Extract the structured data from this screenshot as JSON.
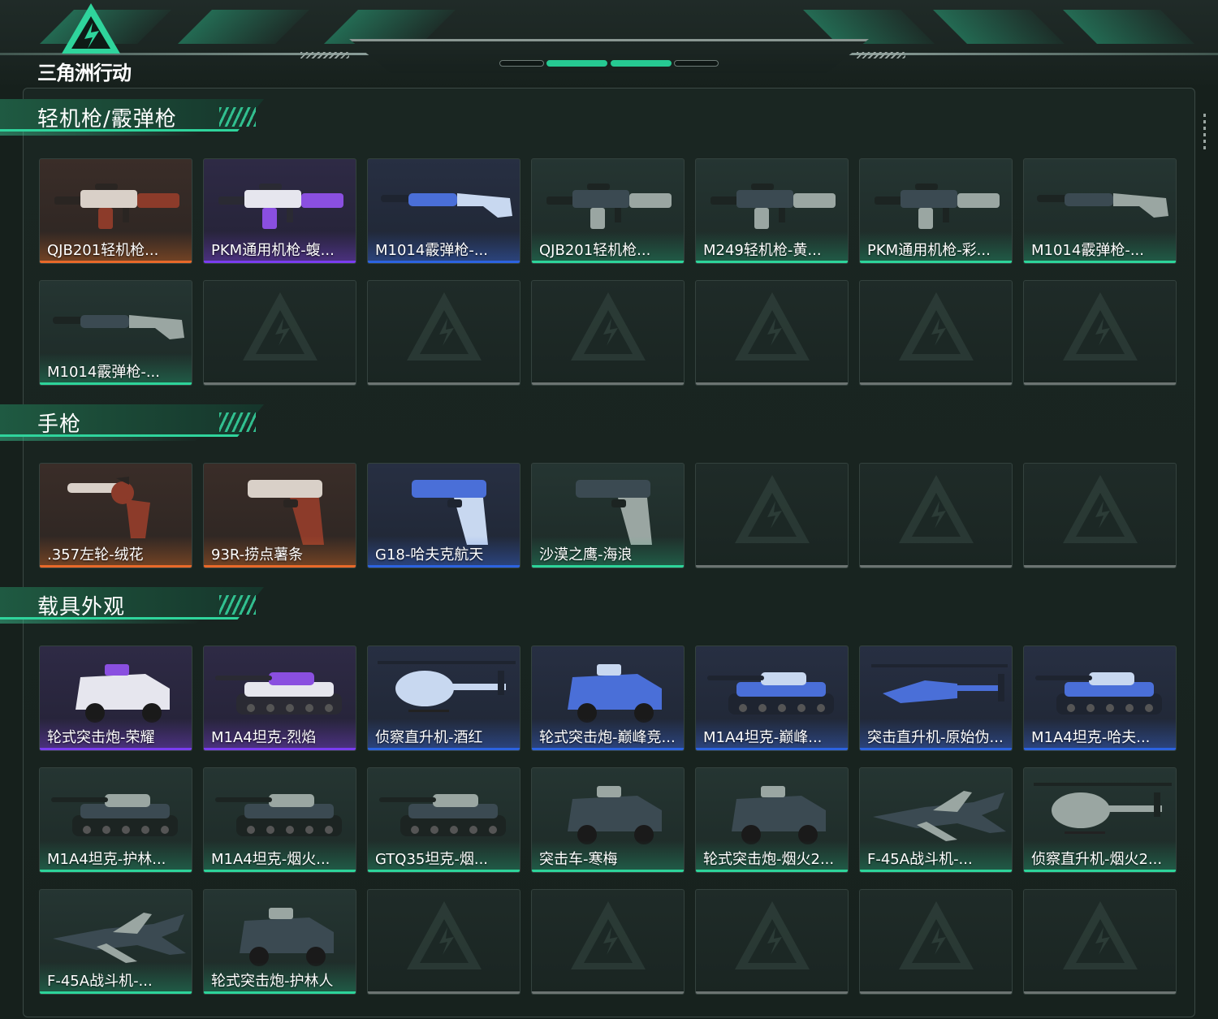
{
  "app": {
    "logo_text": "三角洲行动"
  },
  "colors": {
    "accent_green": "#2dd49a",
    "rarity_orange": "#e8692a",
    "rarity_purple": "#7a3df0",
    "rarity_blue": "#2c63e0",
    "rarity_gray": "#6c7472",
    "background": "#16201c"
  },
  "sections": [
    {
      "title": "轻机枪/霰弹枪",
      "items": [
        {
          "name": "QJB201轻机枪...",
          "rarity": "orange",
          "icon": "machine-gun-icon"
        },
        {
          "name": "PKM通用机枪-蝮...",
          "rarity": "purple",
          "icon": "machine-gun-icon"
        },
        {
          "name": "M1014霰弹枪-...",
          "rarity": "blue",
          "icon": "shotgun-icon"
        },
        {
          "name": "QJB201轻机枪...",
          "rarity": "green",
          "icon": "machine-gun-icon"
        },
        {
          "name": "M249轻机枪-黄...",
          "rarity": "green",
          "icon": "machine-gun-icon"
        },
        {
          "name": "PKM通用机枪-彩...",
          "rarity": "green",
          "icon": "machine-gun-icon"
        },
        {
          "name": "M1014霰弹枪-...",
          "rarity": "green",
          "icon": "shotgun-icon"
        },
        {
          "name": "M1014霰弹枪-...",
          "rarity": "green",
          "icon": "shotgun-icon"
        },
        null,
        null,
        null,
        null,
        null,
        null
      ]
    },
    {
      "title": "手枪",
      "items": [
        {
          "name": ".357左轮-绒花",
          "rarity": "orange",
          "icon": "revolver-icon"
        },
        {
          "name": "93R-捞点薯条",
          "rarity": "orange",
          "icon": "pistol-icon"
        },
        {
          "name": "G18-哈夫克航天",
          "rarity": "blue",
          "icon": "pistol-icon"
        },
        {
          "name": "沙漠之鹰-海浪",
          "rarity": "green",
          "icon": "pistol-icon"
        },
        null,
        null,
        null
      ]
    },
    {
      "title": "载具外观",
      "items": [
        {
          "name": "轮式突击炮-荣耀",
          "rarity": "purple",
          "icon": "armored-car-icon"
        },
        {
          "name": "M1A4坦克-烈焰",
          "rarity": "purple",
          "icon": "tank-icon"
        },
        {
          "name": "侦察直升机-酒红",
          "rarity": "blue",
          "icon": "helicopter-icon"
        },
        {
          "name": "轮式突击炮-巅峰竞...",
          "rarity": "blue",
          "icon": "armored-car-icon"
        },
        {
          "name": "M1A4坦克-巅峰...",
          "rarity": "blue",
          "icon": "tank-icon"
        },
        {
          "name": "突击直升机-原始伪...",
          "rarity": "blue",
          "icon": "attack-helicopter-icon"
        },
        {
          "name": "M1A4坦克-哈夫...",
          "rarity": "blue",
          "icon": "tank-icon"
        },
        {
          "name": "M1A4坦克-护林...",
          "rarity": "green",
          "icon": "tank-icon"
        },
        {
          "name": "M1A4坦克-烟火...",
          "rarity": "green",
          "icon": "tank-icon"
        },
        {
          "name": "GTQ35坦克-烟...",
          "rarity": "green",
          "icon": "tank-icon"
        },
        {
          "name": "突击车-寒梅",
          "rarity": "green",
          "icon": "armored-car-icon"
        },
        {
          "name": "轮式突击炮-烟火2...",
          "rarity": "green",
          "icon": "armored-car-icon"
        },
        {
          "name": "F-45A战斗机-...",
          "rarity": "green",
          "icon": "fighter-jet-icon"
        },
        {
          "name": "侦察直升机-烟火2...",
          "rarity": "green",
          "icon": "helicopter-icon"
        },
        {
          "name": "F-45A战斗机-...",
          "rarity": "green",
          "icon": "fighter-jet-icon"
        },
        {
          "name": "轮式突击炮-护林人",
          "rarity": "green",
          "icon": "armored-car-icon"
        },
        null,
        null,
        null,
        null,
        null
      ]
    }
  ]
}
